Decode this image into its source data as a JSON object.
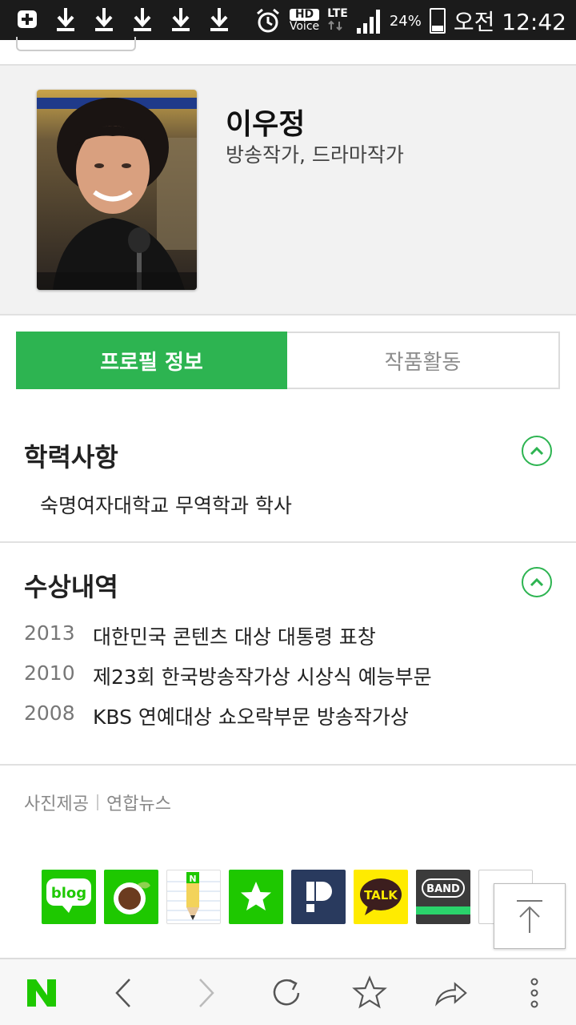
{
  "status_bar": {
    "hd_label": "HD",
    "voice_label": "Voice",
    "lte_label": "LTE",
    "battery": "24%",
    "time": "오전 12:42"
  },
  "profile": {
    "name": "이우정",
    "role": "방송작가, 드라마작가"
  },
  "tabs": [
    {
      "label": "프로필 정보",
      "active": true
    },
    {
      "label": "작품활동",
      "active": false
    }
  ],
  "education": {
    "title": "학력사항",
    "items": [
      "숙명여자대학교 무역학과 학사"
    ]
  },
  "awards": {
    "title": "수상내역",
    "items": [
      {
        "year": "2013",
        "text": "대한민국 콘텐츠 대상 대통령 표창"
      },
      {
        "year": "2010",
        "text": "제23회 한국방송작가상 시상식 예능부문"
      },
      {
        "year": "2008",
        "text": "KBS 연예대상 쇼오락부문 방송작가상"
      }
    ]
  },
  "photo_credit": {
    "label": "사진제공",
    "source": "연합뉴스"
  },
  "share": {
    "blog": "blog",
    "talk": "TALK",
    "band": "BAND",
    "memo_n": "N"
  },
  "colors": {
    "accent_green": "#2db451",
    "naver_green": "#1ec800"
  },
  "browser_nav": {
    "logo": "N",
    "icons": [
      "naver-logo-icon",
      "back-icon",
      "forward-icon",
      "refresh-icon",
      "star-icon",
      "share-icon",
      "more-icon"
    ]
  }
}
